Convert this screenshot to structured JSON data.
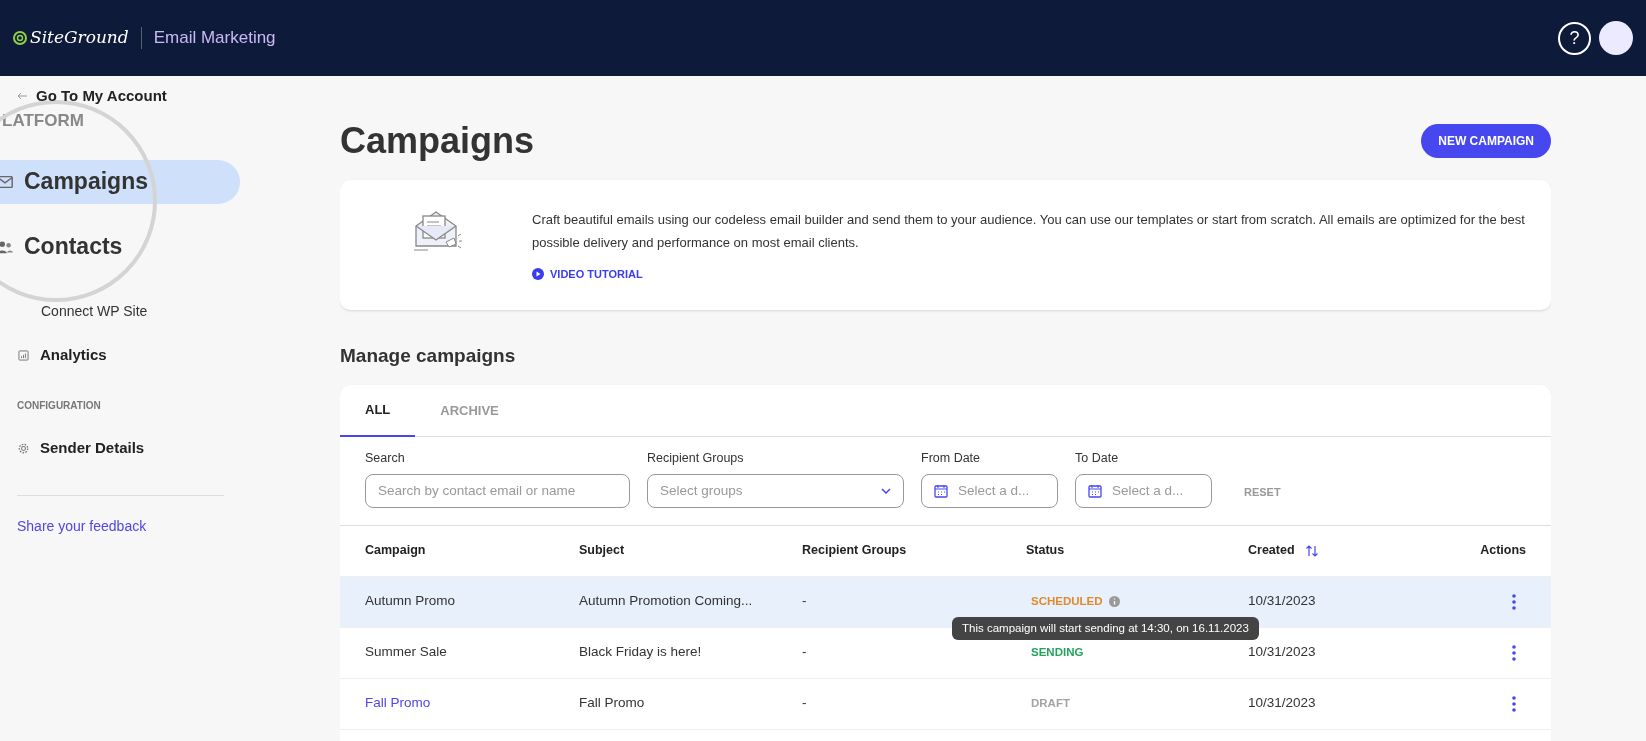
{
  "header": {
    "logo": "SiteGround",
    "product": "Email Marketing",
    "help": "?"
  },
  "sidebar": {
    "back_link": "Go To My Account",
    "sections": [
      {
        "label": "LATFORM",
        "items": [
          {
            "label": "Campaigns",
            "kind": "magnified",
            "selected": true
          },
          {
            "label": "Contacts",
            "kind": "magnified",
            "selected": false
          },
          {
            "label": "Connect WP Site",
            "kind": "sub",
            "selected": false
          },
          {
            "label": "Analytics",
            "kind": "normal",
            "selected": false
          }
        ]
      },
      {
        "label": "CONFIGURATION",
        "items": [
          {
            "label": "Sender Details",
            "kind": "normal",
            "selected": false
          }
        ]
      }
    ],
    "feedback_link": "Share your feedback"
  },
  "main": {
    "title": "Campaigns",
    "new_button": "NEW CAMPAIGN",
    "intro": {
      "text": "Craft beautiful emails using our codeless email builder and send them to your audience. You can use our templates or start from scratch. All emails are optimized for the best possible delivery and performance on most email clients.",
      "video_link": "VIDEO TUTORIAL"
    },
    "section_title": "Manage campaigns",
    "tabs": [
      {
        "label": "ALL",
        "selected": true
      },
      {
        "label": "ARCHIVE",
        "selected": false
      }
    ],
    "filters": [
      {
        "kind": "text",
        "label": "Search",
        "placeholder": "Search by contact email or name"
      },
      {
        "kind": "select",
        "label": "Recipient Groups",
        "placeholder": "Select groups"
      },
      {
        "kind": "date",
        "label": "From Date",
        "placeholder": "Select a d..."
      },
      {
        "kind": "date",
        "label": "To Date",
        "placeholder": "Select a d..."
      }
    ],
    "reset": "RESET",
    "table": {
      "columns": [
        "Campaign",
        "Subject",
        "Recipient Groups",
        "Status",
        "Created",
        "Actions"
      ],
      "rows": [
        {
          "campaign": "Autumn Promo",
          "link": false,
          "subject": "Autumn Promotion Coming...",
          "groups": "-",
          "status": "SCHEDULED",
          "color": "#e08a2c",
          "info": true,
          "created": "10/31/2023",
          "selected": true
        },
        {
          "campaign": "Summer Sale",
          "link": false,
          "subject": "Black Friday is here!",
          "groups": "-",
          "status": "SENDING",
          "color": "#22a45d",
          "info": false,
          "created": "10/31/2023",
          "selected": false
        },
        {
          "campaign": "Fall Promo",
          "link": true,
          "subject": "Fall Promo",
          "groups": "-",
          "status": "DRAFT",
          "color": "#a3a3a3",
          "info": false,
          "created": "10/31/2023",
          "selected": false
        }
      ],
      "tooltip": "This campaign will start sending at 14:30, on 16.11.2023"
    }
  }
}
